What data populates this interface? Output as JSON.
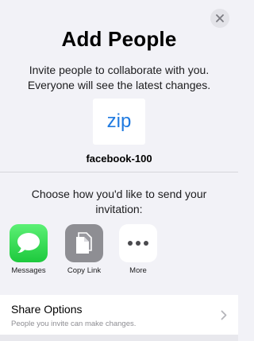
{
  "sheet": {
    "close_icon": "close-icon",
    "title": "Add People",
    "subtitle": "Invite people to collaborate with you. Everyone will see the latest changes.",
    "thumbnail_text": "zip",
    "filename": "facebook-100",
    "prompt": "Choose how you'd like to send your invitation:"
  },
  "share_apps": [
    {
      "label": "Messages",
      "icon": "messages-icon",
      "color": "#34c759"
    },
    {
      "label": "Copy Link",
      "icon": "copy-link-icon",
      "color": "#8e8e93"
    },
    {
      "label": "More",
      "icon": "more-icon",
      "color": "#ffffff"
    }
  ],
  "share_options": {
    "title": "Share Options",
    "subtitle": "People you invite can make changes."
  },
  "colors": {
    "accent": "#1f7ae0",
    "background": "#f2f2f7"
  }
}
